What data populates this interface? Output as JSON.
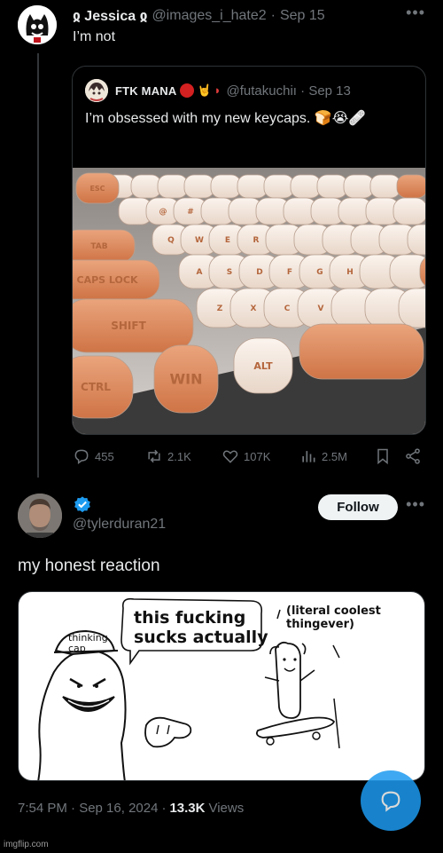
{
  "parent_tweet": {
    "display_name": "ჲ Jessica ჲ",
    "handle": "@images_i_hate2",
    "date": "Sep 15",
    "text": "I’m not"
  },
  "quoted_tweet": {
    "display_name": "FTK MANA",
    "handle": "@futakuchiı",
    "date": "Sep 13",
    "text": "I’m obsessed with my new keycaps. 🍞😭🩹",
    "keycap_labels": [
      "ESC",
      "TAB",
      "CAPS LOCK",
      "SHIFT",
      "CTRL",
      "WIN",
      "ALT",
      "Q",
      "W",
      "E",
      "R",
      "A",
      "S",
      "D",
      "F",
      "G",
      "H",
      "Z",
      "X",
      "C",
      "V",
      "@",
      "#"
    ]
  },
  "actions": {
    "replies": "455",
    "reposts": "2.1K",
    "likes": "107K",
    "views": "2.5M"
  },
  "reply_tweet": {
    "handle": "@tylerduran21",
    "follow_label": "Follow",
    "text": "my honest reaction",
    "meme": {
      "speech_bubble": "this fucking sucks actually",
      "speech_line1": "this fucking",
      "speech_line2": "sucks actually",
      "right_caption": "(literal coolest thingever)",
      "hat_label_line1": "thinking",
      "hat_label_line2": "cap"
    },
    "timestamp": "7:54 PM · Sep 16, 2024",
    "views_count": "13.3K",
    "views_label": "Views"
  },
  "watermark": "imgflip.com",
  "colors": {
    "background": "#000000",
    "text_primary": "#e7e9ea",
    "text_secondary": "#71767b",
    "accent_blue": "#1d9bf0",
    "border": "#2f3336"
  }
}
